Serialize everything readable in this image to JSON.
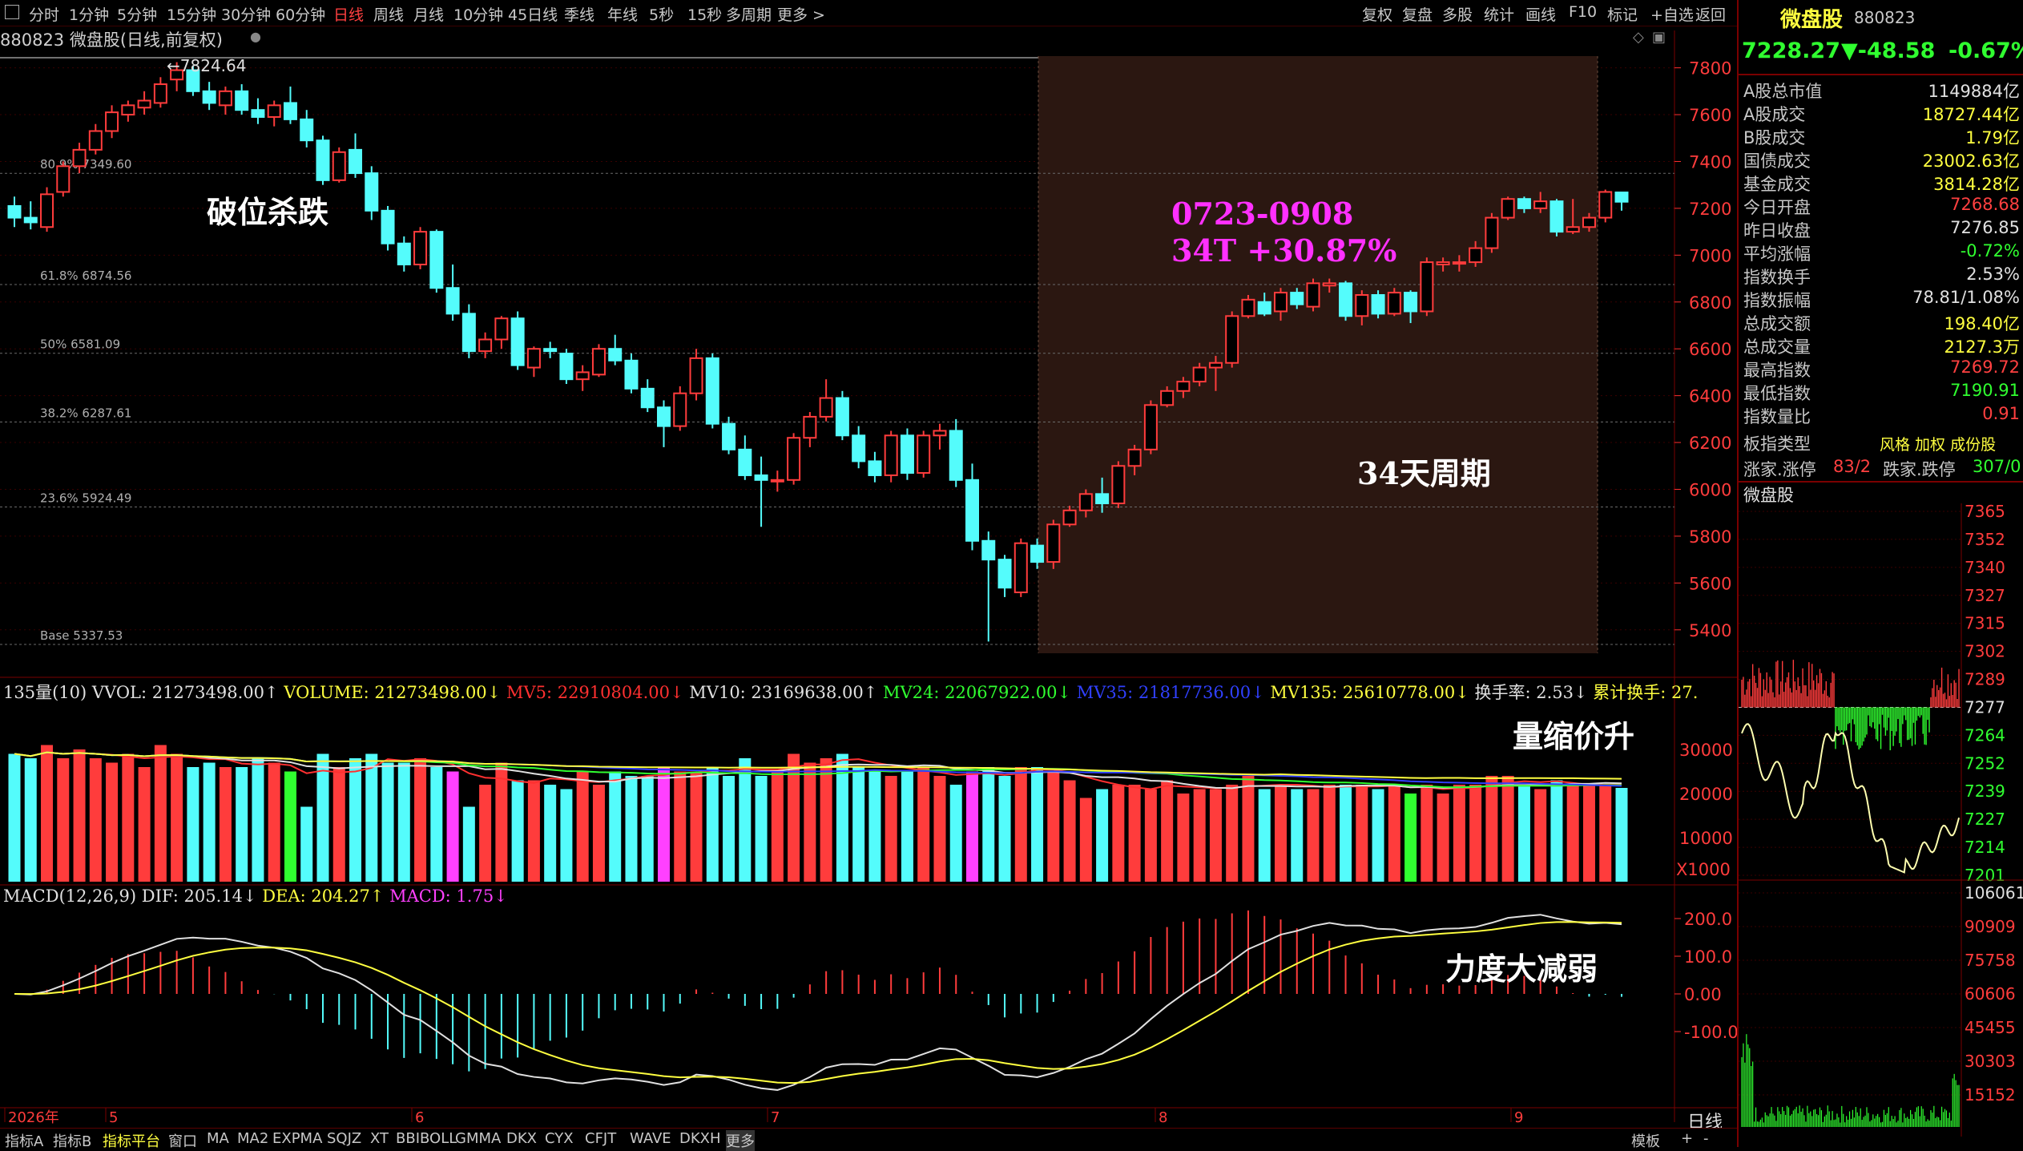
{
  "tabs": [
    "分时",
    "1分钟",
    "5分钟",
    "15分钟",
    "30分钟",
    "60分钟",
    "日线",
    "周线",
    "月线",
    "10分钟",
    "45日线",
    "季线",
    "年线",
    "5秒",
    "15秒",
    "多周期",
    "更多 >"
  ],
  "active_tab": "日线",
  "right_buttons": [
    "复权",
    "复盘",
    "多股",
    "统计",
    "画线",
    "F10",
    "标记",
    "+自选",
    "返回"
  ],
  "title": "880823 微盘股(日线,前复权)",
  "high_label": "7824.64",
  "fib_labels": [
    "80.9% 7349.60",
    "61.8% 6874.56",
    "50% 6581.09",
    "38.2% 6287.61",
    "23.6% 5924.49",
    "Base 5337.53"
  ],
  "price_axis": [
    "7800",
    "7600",
    "7400",
    "7200",
    "7000",
    "6800",
    "6600",
    "6400",
    "6200",
    "6000",
    "5800",
    "5600",
    "5400"
  ],
  "annotations": {
    "break_down": "破位杀跌",
    "period_dates": "0723-0908",
    "period_gain": "34T  +30.87%",
    "cycle": "34天周期",
    "vol_note": "量缩价升",
    "macd_note": "力度大减弱"
  },
  "volume_header": [
    {
      "text": "135量(10) VVOL: 21273498.00↑",
      "color": "#e0e0e0"
    },
    {
      "text": "VOLUME: 21273498.00↓",
      "color": "#ffff40"
    },
    {
      "text": "MV5: 22910804.00↓",
      "color": "#ff3030"
    },
    {
      "text": "MV10: 23169638.00↑",
      "color": "#e0e0e0"
    },
    {
      "text": "MV24: 22067922.00↓",
      "color": "#30ff30"
    },
    {
      "text": "MV35: 21817736.00↓",
      "color": "#3040ff"
    },
    {
      "text": "MV135: 25610778.00↓",
      "color": "#ffff40"
    },
    {
      "text": "换手率: 2.53↓",
      "color": "#e0e0e0"
    },
    {
      "text": "累计换手: 27.",
      "color": "#ffff40"
    }
  ],
  "volume_axis": [
    "30000",
    "20000",
    "10000",
    "X1000"
  ],
  "macd_header": [
    {
      "text": "MACD(12,26,9) DIF: 205.14↓",
      "color": "#e0e0e0"
    },
    {
      "text": "DEA: 204.27↑",
      "color": "#ffff40"
    },
    {
      "text": "MACD: 1.75↓",
      "color": "#ff40ff"
    }
  ],
  "macd_axis": [
    "200.0",
    "100.0",
    "0.00",
    "-100.0"
  ],
  "date_axis": [
    "2026年",
    "5",
    "6",
    "7",
    "8",
    "9"
  ],
  "date_period_label": "日线",
  "right_panel": {
    "name": "微盘股",
    "code": "880823",
    "price": "7228.27",
    "change": "▼-48.58",
    "pct": "-0.67%",
    "rows": [
      {
        "label": "A股总市值",
        "value": "1149884亿",
        "color": "#e0e0e0"
      },
      {
        "label": "A股成交",
        "value": "18727.44亿",
        "color": "#ffff40"
      },
      {
        "label": "B股成交",
        "value": "1.79亿",
        "color": "#ffff40"
      },
      {
        "label": "国债成交",
        "value": "23002.63亿",
        "color": "#ffff40"
      },
      {
        "label": "基金成交",
        "value": "3814.28亿",
        "color": "#ffff40"
      },
      {
        "label": "今日开盘",
        "value": "7268.68",
        "color": "#ff4040"
      },
      {
        "label": "昨日收盘",
        "value": "7276.85",
        "color": "#e0e0e0"
      },
      {
        "label": "平均涨幅",
        "value": "-0.72%",
        "color": "#30ff30"
      },
      {
        "label": "指数换手",
        "value": "2.53%",
        "color": "#e0e0e0"
      },
      {
        "label": "指数振幅",
        "value": "78.81/1.08%",
        "color": "#e0e0e0"
      },
      {
        "label": "总成交额",
        "value": "198.40亿",
        "color": "#ffff40"
      },
      {
        "label": "总成交量",
        "value": "2127.3万",
        "color": "#ffff40"
      },
      {
        "label": "最高指数",
        "value": "7269.72",
        "color": "#ff4040"
      },
      {
        "label": "最低指数",
        "value": "7190.91",
        "color": "#30ff30"
      },
      {
        "label": "指数量比",
        "value": "0.91",
        "color": "#ff4040"
      }
    ],
    "index_type_label": "板指类型",
    "index_type_value": "风格 加权 成份股",
    "limit_up_label": "涨家.涨停",
    "limit_up_value": "83/2",
    "limit_down_label": "跌家.跌停",
    "limit_down_value": "307/0",
    "mini_title": "微盘股",
    "mini_price_axis": [
      "7365",
      "7352",
      "7340",
      "7327",
      "7315",
      "7302",
      "7289",
      "7277",
      "7264",
      "7252",
      "7239",
      "7227",
      "7214",
      "7201"
    ],
    "mini_vol_axis": [
      "106061",
      "90909",
      "75758",
      "60606",
      "45455",
      "30303",
      "15152"
    ]
  },
  "bottom_tabs": [
    "指标A",
    "指标B",
    "指标平台",
    "窗口",
    "MA",
    "MA2",
    "EXPMA",
    "SQJZ",
    "XT",
    "BBIBOLL",
    "GMMA",
    "DKX",
    "CYX",
    "CFJT",
    "WAVE",
    "DKXH",
    "更多"
  ],
  "bottom_right": [
    "模板",
    "+",
    "-"
  ],
  "colors": {
    "up": "#ff3c3c",
    "down": "#54fcfc",
    "bg": "#000000",
    "grid": "#5a0000",
    "highlight": "#2a1610"
  },
  "chart_data": {
    "type": "candlestick",
    "title": "880823 微盘股(日线,前复权)",
    "ylim": [
      5300,
      7850
    ],
    "ohlc": [
      [
        7210,
        7250,
        7120,
        7160
      ],
      [
        7160,
        7230,
        7110,
        7140
      ],
      [
        7120,
        7290,
        7100,
        7260
      ],
      [
        7270,
        7400,
        7250,
        7380
      ],
      [
        7380,
        7480,
        7350,
        7450
      ],
      [
        7450,
        7560,
        7430,
        7530
      ],
      [
        7530,
        7640,
        7500,
        7610
      ],
      [
        7600,
        7660,
        7570,
        7640
      ],
      [
        7630,
        7700,
        7600,
        7660
      ],
      [
        7650,
        7760,
        7630,
        7730
      ],
      [
        7750,
        7824,
        7700,
        7790
      ],
      [
        7790,
        7810,
        7680,
        7700
      ],
      [
        7700,
        7740,
        7620,
        7650
      ],
      [
        7640,
        7720,
        7600,
        7700
      ],
      [
        7700,
        7730,
        7600,
        7620
      ],
      [
        7620,
        7670,
        7560,
        7590
      ],
      [
        7590,
        7660,
        7550,
        7640
      ],
      [
        7650,
        7720,
        7560,
        7580
      ],
      [
        7580,
        7620,
        7460,
        7490
      ],
      [
        7490,
        7510,
        7300,
        7320
      ],
      [
        7320,
        7460,
        7310,
        7440
      ],
      [
        7450,
        7520,
        7330,
        7350
      ],
      [
        7350,
        7380,
        7150,
        7190
      ],
      [
        7190,
        7210,
        7020,
        7050
      ],
      [
        7050,
        7080,
        6930,
        6960
      ],
      [
        6960,
        7120,
        6940,
        7100
      ],
      [
        7100,
        7110,
        6840,
        6860
      ],
      [
        6860,
        6960,
        6720,
        6750
      ],
      [
        6750,
        6790,
        6560,
        6590
      ],
      [
        6590,
        6670,
        6560,
        6640
      ],
      [
        6640,
        6740,
        6600,
        6730
      ],
      [
        6730,
        6760,
        6510,
        6530
      ],
      [
        6520,
        6610,
        6480,
        6600
      ],
      [
        6600,
        6630,
        6560,
        6590
      ],
      [
        6580,
        6600,
        6450,
        6470
      ],
      [
        6470,
        6530,
        6420,
        6500
      ],
      [
        6490,
        6620,
        6480,
        6600
      ],
      [
        6600,
        6660,
        6530,
        6550
      ],
      [
        6550,
        6580,
        6410,
        6430
      ],
      [
        6430,
        6470,
        6330,
        6350
      ],
      [
        6350,
        6380,
        6180,
        6270
      ],
      [
        6270,
        6440,
        6250,
        6410
      ],
      [
        6410,
        6600,
        6380,
        6560
      ],
      [
        6560,
        6580,
        6260,
        6280
      ],
      [
        6280,
        6310,
        6150,
        6170
      ],
      [
        6170,
        6230,
        6040,
        6060
      ],
      [
        6060,
        6140,
        5840,
        6040
      ],
      [
        6040,
        6080,
        5990,
        6040
      ],
      [
        6040,
        6240,
        6020,
        6220
      ],
      [
        6220,
        6330,
        6180,
        6310
      ],
      [
        6310,
        6470,
        6290,
        6390
      ],
      [
        6390,
        6420,
        6210,
        6230
      ],
      [
        6230,
        6270,
        6090,
        6120
      ],
      [
        6120,
        6160,
        6030,
        6060
      ],
      [
        6060,
        6250,
        6030,
        6230
      ],
      [
        6230,
        6260,
        6040,
        6070
      ],
      [
        6070,
        6250,
        6050,
        6230
      ],
      [
        6230,
        6280,
        6170,
        6250
      ],
      [
        6250,
        6300,
        6010,
        6040
      ],
      [
        6040,
        6110,
        5740,
        5780
      ],
      [
        5780,
        5820,
        5350,
        5700
      ],
      [
        5700,
        5720,
        5540,
        5580
      ],
      [
        5560,
        5790,
        5540,
        5770
      ],
      [
        5760,
        5790,
        5660,
        5690
      ],
      [
        5690,
        5870,
        5660,
        5850
      ],
      [
        5850,
        5930,
        5840,
        5910
      ],
      [
        5910,
        6000,
        5880,
        5980
      ],
      [
        5980,
        6050,
        5900,
        5940
      ],
      [
        5940,
        6120,
        5920,
        6100
      ],
      [
        6100,
        6190,
        6060,
        6170
      ],
      [
        6170,
        6380,
        6150,
        6360
      ],
      [
        6360,
        6440,
        6350,
        6420
      ],
      [
        6420,
        6480,
        6390,
        6460
      ],
      [
        6460,
        6540,
        6440,
        6520
      ],
      [
        6520,
        6570,
        6420,
        6540
      ],
      [
        6540,
        6760,
        6520,
        6740
      ],
      [
        6740,
        6830,
        6730,
        6810
      ],
      [
        6800,
        6840,
        6740,
        6750
      ],
      [
        6760,
        6860,
        6720,
        6840
      ],
      [
        6840,
        6860,
        6770,
        6790
      ],
      [
        6780,
        6900,
        6760,
        6880
      ],
      [
        6870,
        6900,
        6840,
        6880
      ],
      [
        6880,
        6890,
        6720,
        6740
      ],
      [
        6740,
        6850,
        6700,
        6830
      ],
      [
        6830,
        6850,
        6730,
        6750
      ],
      [
        6750,
        6860,
        6740,
        6840
      ],
      [
        6840,
        6850,
        6710,
        6760
      ],
      [
        6760,
        6990,
        6740,
        6970
      ],
      [
        6960,
        6990,
        6930,
        6970
      ],
      [
        6970,
        7000,
        6930,
        6970
      ],
      [
        6970,
        7060,
        6950,
        7030
      ],
      [
        7030,
        7180,
        7010,
        7160
      ],
      [
        7160,
        7250,
        7150,
        7240
      ],
      [
        7240,
        7250,
        7180,
        7200
      ],
      [
        7200,
        7270,
        7180,
        7230
      ],
      [
        7230,
        7240,
        7080,
        7100
      ],
      [
        7100,
        7240,
        7090,
        7120
      ],
      [
        7120,
        7180,
        7100,
        7160
      ],
      [
        7160,
        7280,
        7140,
        7270
      ],
      [
        7268,
        7269,
        7190,
        7228
      ]
    ],
    "volume": [
      29000,
      28000,
      31000,
      28000,
      30000,
      28000,
      27000,
      29000,
      26000,
      31000,
      29000,
      26000,
      27000,
      26000,
      26000,
      28000,
      27000,
      25000,
      17000,
      29000,
      26000,
      28000,
      29000,
      27000,
      27000,
      28000,
      26000,
      25000,
      17000,
      22000,
      27000,
      23000,
      23000,
      22000,
      21000,
      25000,
      22000,
      25000,
      24000,
      24000,
      26000,
      25000,
      25000,
      26000,
      24000,
      28000,
      24000,
      25000,
      29000,
      27000,
      28000,
      29000,
      26000,
      25000,
      24000,
      25000,
      26000,
      24000,
      22000,
      25000,
      26000,
      24000,
      26000,
      26000,
      25000,
      23000,
      19000,
      21000,
      22000,
      22000,
      21000,
      23000,
      20000,
      21000,
      21000,
      22000,
      24000,
      21000,
      22000,
      21000,
      21000,
      22000,
      22000,
      22000,
      21000,
      22000,
      20000,
      22000,
      20000,
      22000,
      22000,
      24000,
      24000,
      22000,
      21000,
      23000,
      22000,
      22000,
      22000,
      21273
    ]
  }
}
